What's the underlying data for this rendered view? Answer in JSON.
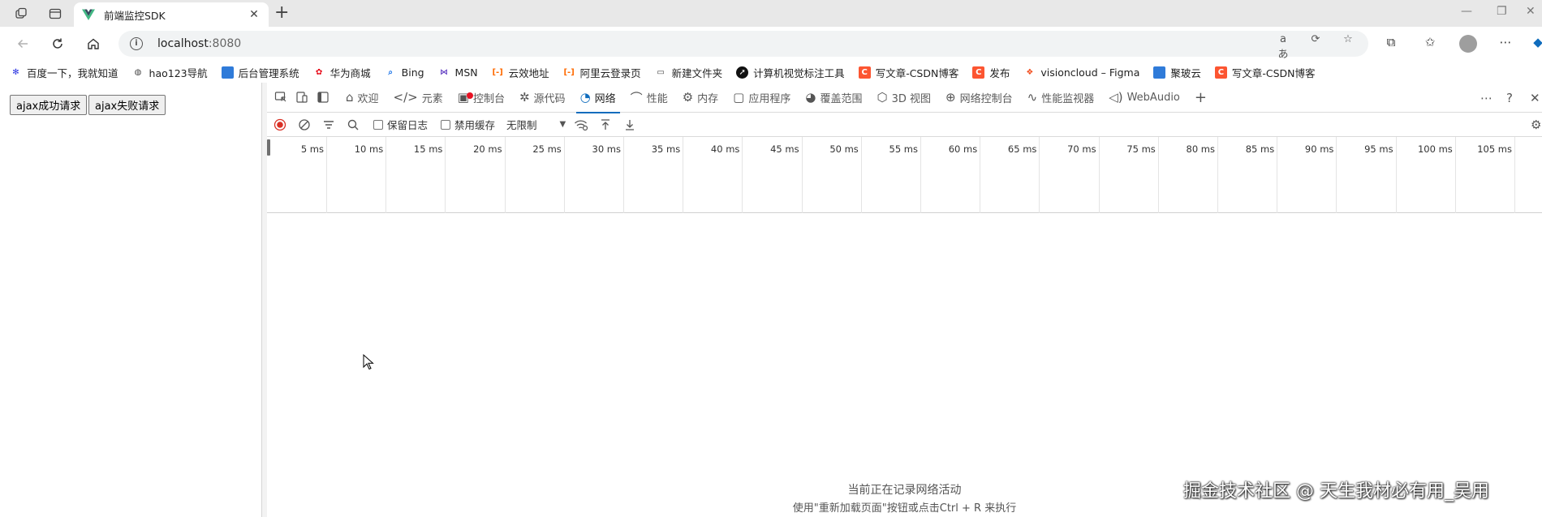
{
  "browser": {
    "tab_title": "前端监控SDK",
    "url_host": "localhost",
    "url_port": ":8080"
  },
  "bookmarks": [
    {
      "label": "百度一下，我就知道",
      "icon": "baidu-paw-icon",
      "color": "#2932e1"
    },
    {
      "label": "hao123导航",
      "icon": "globe-icon",
      "color": "#444444"
    },
    {
      "label": "后台管理系统",
      "icon": "bookmark-blue-icon",
      "color": "#2f7bd9"
    },
    {
      "label": "华为商城",
      "icon": "huawei-icon",
      "color": "#e60012"
    },
    {
      "label": "Bing",
      "icon": "search-icon",
      "color": "#1a73e8"
    },
    {
      "label": "MSN",
      "icon": "msn-butterfly-icon",
      "color": "#6d4cc7"
    },
    {
      "label": "云效地址",
      "icon": "aliyun-icon",
      "color": "#ff6a00"
    },
    {
      "label": "阿里云登录页",
      "icon": "aliyun-icon",
      "color": "#ff6a00"
    },
    {
      "label": "新建文件夹",
      "icon": "folder-icon",
      "color": "#444444"
    },
    {
      "label": "计算机视觉标注工具",
      "icon": "arrow-circle-icon",
      "color": "#111111"
    },
    {
      "label": "写文章-CSDN博客",
      "icon": "csdn-icon",
      "color": "#fc5531"
    },
    {
      "label": "发布",
      "icon": "csdn-icon",
      "color": "#fc5531"
    },
    {
      "label": "visioncloud – Figma",
      "icon": "figma-icon",
      "color": "#f24e1e"
    },
    {
      "label": "聚玻云",
      "icon": "bookmark-blue-icon",
      "color": "#2f7bd9"
    },
    {
      "label": "写文章-CSDN博客",
      "icon": "csdn-icon",
      "color": "#fc5531"
    }
  ],
  "page": {
    "btn_success": "ajax成功请求",
    "btn_fail": "ajax失败请求"
  },
  "devtools": {
    "tabs": [
      {
        "label": "欢迎",
        "icon": "home-icon"
      },
      {
        "label": "元素",
        "icon": "code-icon"
      },
      {
        "label": "控制台",
        "icon": "console-icon"
      },
      {
        "label": "源代码",
        "icon": "bug-icon"
      },
      {
        "label": "网络",
        "icon": "wifi-icon",
        "active": true
      },
      {
        "label": "性能",
        "icon": "performance-icon"
      },
      {
        "label": "内存",
        "icon": "memory-icon"
      },
      {
        "label": "应用程序",
        "icon": "application-icon"
      },
      {
        "label": "覆盖范围",
        "icon": "coverage-icon"
      },
      {
        "label": "3D 视图",
        "icon": "cube-icon"
      },
      {
        "label": "网络控制台",
        "icon": "network-console-icon"
      },
      {
        "label": "性能监视器",
        "icon": "monitor-icon"
      },
      {
        "label": "WebAudio",
        "icon": "speaker-icon"
      }
    ],
    "network_toolbar": {
      "preserve_log": "保留日志",
      "disable_cache": "禁用缓存",
      "throttling": "无限制"
    },
    "timeline_ticks": [
      "5 ms",
      "10 ms",
      "15 ms",
      "20 ms",
      "25 ms",
      "30 ms",
      "35 ms",
      "40 ms",
      "45 ms",
      "50 ms",
      "55 ms",
      "60 ms",
      "65 ms",
      "70 ms",
      "75 ms",
      "80 ms",
      "85 ms",
      "90 ms",
      "95 ms",
      "100 ms",
      "105 ms"
    ],
    "recording_msg": "当前正在记录网络活动",
    "reload_hint": "使用\"重新加载页面\"按钮或点击Ctrl + R 来执行"
  },
  "watermark": "掘金技术社区 @ 天生我材必有用_吴用"
}
